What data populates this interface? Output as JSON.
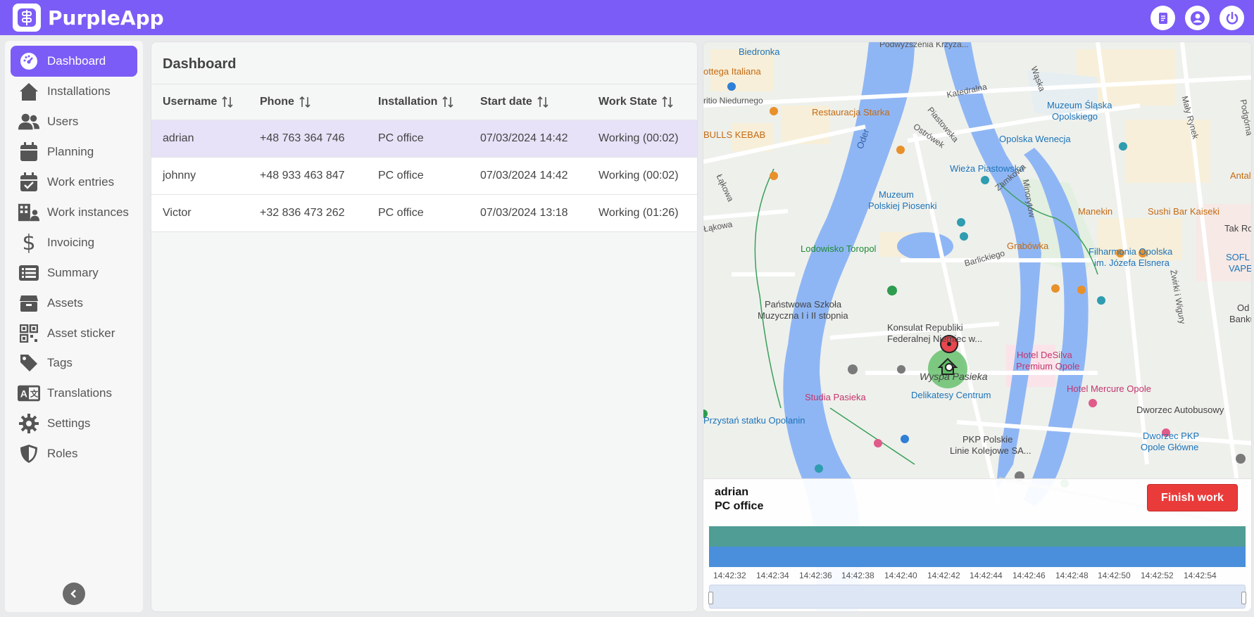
{
  "app": {
    "title": "PurpleApp"
  },
  "topbar": {
    "icons": [
      "document-icon",
      "user-icon",
      "power-icon"
    ]
  },
  "sidebar": {
    "items": [
      {
        "label": "Dashboard",
        "icon": "dashboard-icon",
        "active": true
      },
      {
        "label": "Installations",
        "icon": "home-icon"
      },
      {
        "label": "Users",
        "icon": "users-icon"
      },
      {
        "label": "Planning",
        "icon": "calendar-icon"
      },
      {
        "label": "Work entries",
        "icon": "calendar-check-icon"
      },
      {
        "label": "Work instances",
        "icon": "building-user-icon"
      },
      {
        "label": "Invoicing",
        "icon": "dollar-icon"
      },
      {
        "label": "Summary",
        "icon": "list-icon"
      },
      {
        "label": "Assets",
        "icon": "box-icon"
      },
      {
        "label": "Asset sticker",
        "icon": "qr-icon"
      },
      {
        "label": "Tags",
        "icon": "tag-icon"
      },
      {
        "label": "Translations",
        "icon": "translate-icon"
      },
      {
        "label": "Settings",
        "icon": "gear-icon"
      },
      {
        "label": "Roles",
        "icon": "shield-icon"
      }
    ],
    "collapse_icon": "chevron-left-icon"
  },
  "main": {
    "title": "Dashboard",
    "columns": [
      "Username",
      "Phone",
      "Installation",
      "Start date",
      "Work State"
    ],
    "rows": [
      {
        "username": "adrian",
        "phone": "+48 763 364 746",
        "installation": "PC office",
        "start": "07/03/2024 14:42",
        "state": "Working (00:02)",
        "selected": true
      },
      {
        "username": "johnny",
        "phone": "+48 933 463 847",
        "installation": "PC office",
        "start": "07/03/2024 14:42",
        "state": "Working (00:02)"
      },
      {
        "username": "Victor",
        "phone": "+32 836 473 262",
        "installation": "PC office",
        "start": "07/03/2024 13:18",
        "state": "Working (01:26)"
      }
    ]
  },
  "map": {
    "labels": {
      "biedronka": "Biedronka",
      "ottega": "ottega Italiana",
      "niedurnego": "ritio Niedurnego",
      "starka": "Restauracja Starka",
      "bulls": "BULLS KEBAB",
      "muzeum_slaska": "Muzeum Śląska",
      "opolskiego": "Opolskiego",
      "wenecja": "Opolska Wenecja",
      "wieza": "Wieża Piastowska",
      "muzeum_piosenki": "Muzeum",
      "muzeum_piosenki2": "Polskiej Piosenki",
      "manekin": "Manekin",
      "sushi": "Sushi Bar Kaiseki",
      "antalya": "Antalya",
      "tak_ro": "Tak Ro",
      "lodowisko": "Lodowisko Toropol",
      "grabowka": "Grabówka",
      "filharmonia": "Filharmonia Opolska",
      "filharmonia2": "im. Józefa Elsnera",
      "szkola": "Państwowa Szkoła",
      "szkola2": "Muzyczna I i II stopnia",
      "konsulat": "Konsulat Republiki",
      "konsulat2": "Federalnej Niemiec w...",
      "wyspa": "Wyspa Pasieka",
      "desilva": "Hotel DeSilva",
      "desilva2": "Premium Opole",
      "mercure": "Hotel Mercure Opole",
      "studia": "Studia Pasieka",
      "delikatesy": "Delikatesy Centrum",
      "przystan": "Przystań statku Opolanin",
      "dworzec_auto": "Dworzec Autobusowy",
      "pkp": "PKP Polskie",
      "pkp2": "Linie Kolejowe SA...",
      "dworzec_pkp": "Dworzec PKP",
      "dworzec_pkp2": "Opole Główne",
      "podwyzszenia": "Podwyższenia Krzyża...",
      "katedralna": "Katedralna",
      "piastowska": "Piastowska",
      "ostrowek": "Ostrówek",
      "oder": "Oder",
      "lakowa": "Łąkowa",
      "lakowa2": "Łąkowa",
      "zamkowa": "Zamkowa",
      "minorytow": "Minorytów",
      "barlickiego": "Barlickiego",
      "zwirki": "Żwirki i Wigury",
      "maly_rynek": "Mały Rynek",
      "podgorna": "Podgórna",
      "waska": "Wąska",
      "sofl": "SOFL",
      "vape": "VAPE",
      "banku": "Banku",
      "od": "Od"
    }
  },
  "info_card": {
    "username": "adrian",
    "installation": "PC office",
    "finish_button": "Finish work",
    "ticks": [
      "14:42:32",
      "14:42:34",
      "14:42:36",
      "14:42:38",
      "14:42:40",
      "14:42:42",
      "14:42:44",
      "14:42:46",
      "14:42:48",
      "14:42:50",
      "14:42:52",
      "14:42:54"
    ]
  },
  "colors": {
    "brand": "#7c5cf6",
    "selected_row": "#e7e2f8",
    "finish_button": "#ea3b3b",
    "timeline_teal": "#4f9d94",
    "timeline_blue": "#4a8fdb"
  }
}
